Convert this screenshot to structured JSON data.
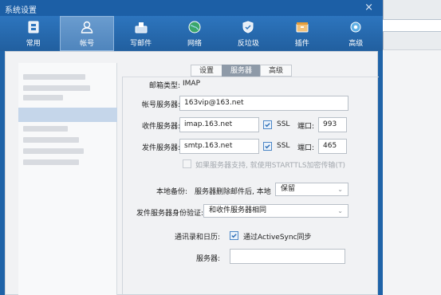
{
  "window": {
    "title": "系统设置",
    "close": "×"
  },
  "toolbar": {
    "items": [
      {
        "label": "常用",
        "icon": "general-icon"
      },
      {
        "label": "帐号",
        "icon": "account-icon"
      },
      {
        "label": "写邮件",
        "icon": "compose-icon"
      },
      {
        "label": "网络",
        "icon": "network-icon"
      },
      {
        "label": "反垃圾",
        "icon": "antispam-icon"
      },
      {
        "label": "插件",
        "icon": "plugin-icon"
      },
      {
        "label": "高级",
        "icon": "advanced-icon"
      }
    ],
    "active": "帐号"
  },
  "tabs": {
    "items": [
      "设置",
      "服务器",
      "高级"
    ],
    "active": "服务器"
  },
  "form": {
    "mailbox_type_label": "邮箱类型:",
    "mailbox_type_value": "IMAP",
    "account_server_label": "帐号服务器:",
    "account_server_value": "163vip@163.net",
    "incoming_label": "收件服务器:",
    "incoming_value": "imap.163.net",
    "incoming_ssl_label": "SSL",
    "incoming_port_label": "端口:",
    "incoming_port_value": "993",
    "outgoing_label": "发件服务器:",
    "outgoing_value": "smtp.163.net",
    "outgoing_ssl_label": "SSL",
    "outgoing_port_label": "端口:",
    "outgoing_port_value": "465",
    "starttls_label": "如果服务器支持, 就使用STARTTLS加密传输(T)",
    "backup_label": "本地备份:",
    "backup_desc": "服务器删除邮件后, 本地",
    "backup_value": "保留",
    "auth_label": "发件服务器身份验证:",
    "auth_value": "和收件服务器相同",
    "contacts_label": "通讯录和日历:",
    "activesync_label": "通过ActiveSync同步",
    "server_label": "服务器:",
    "server_value": ""
  },
  "colors": {
    "titlebar": "#1c5fa6",
    "active_tab": "#8e9aa8",
    "accent": "#4d87c7"
  }
}
